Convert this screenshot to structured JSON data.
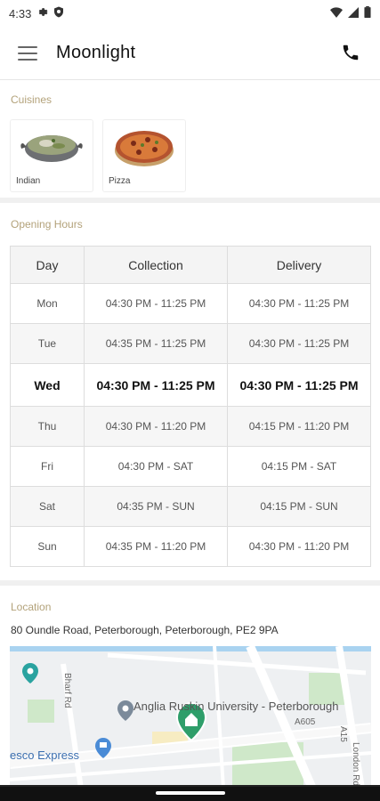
{
  "status_bar": {
    "time": "4:33"
  },
  "app_bar": {
    "title": "Moonlight"
  },
  "cuisines": {
    "label": "Cuisines",
    "items": [
      {
        "label": "Indian"
      },
      {
        "label": "Pizza"
      }
    ]
  },
  "opening_hours": {
    "label": "Opening Hours",
    "headers": [
      "Day",
      "Collection",
      "Delivery"
    ],
    "rows": [
      {
        "day": "Mon",
        "collection": "04:30 PM - 11:25 PM",
        "delivery": "04:30 PM - 11:25 PM"
      },
      {
        "day": "Tue",
        "collection": "04:35 PM - 11:25 PM",
        "delivery": "04:30 PM - 11:25 PM"
      },
      {
        "day": "Wed",
        "collection": "04:30 PM - 11:25 PM",
        "delivery": "04:30 PM - 11:25 PM"
      },
      {
        "day": "Thu",
        "collection": "04:30 PM - 11:20 PM",
        "delivery": "04:15 PM - 11:20 PM"
      },
      {
        "day": "Fri",
        "collection": "04:30 PM - SAT",
        "delivery": "04:15 PM - SAT"
      },
      {
        "day": "Sat",
        "collection": "04:35 PM - SUN",
        "delivery": "04:15 PM - SUN"
      },
      {
        "day": "Sun",
        "collection": "04:35 PM - 11:20 PM",
        "delivery": "04:30 PM - 11:20 PM"
      }
    ]
  },
  "location": {
    "label": "Location",
    "address": "80 Oundle Road, Peterborough, Peterborough, PE2 9PA",
    "map": {
      "poi_university": "Anglia Ruskin University - Peterborough",
      "poi_store": "esco Express",
      "road_a15": "A15",
      "road_a605": "A605",
      "road_london": "London Rd",
      "road_bharf": "Bharf Rd"
    }
  },
  "colors": {
    "section_label": "#b3a27a",
    "map_pin": "#2e9e6a",
    "store_pin": "#4a8bd6"
  }
}
